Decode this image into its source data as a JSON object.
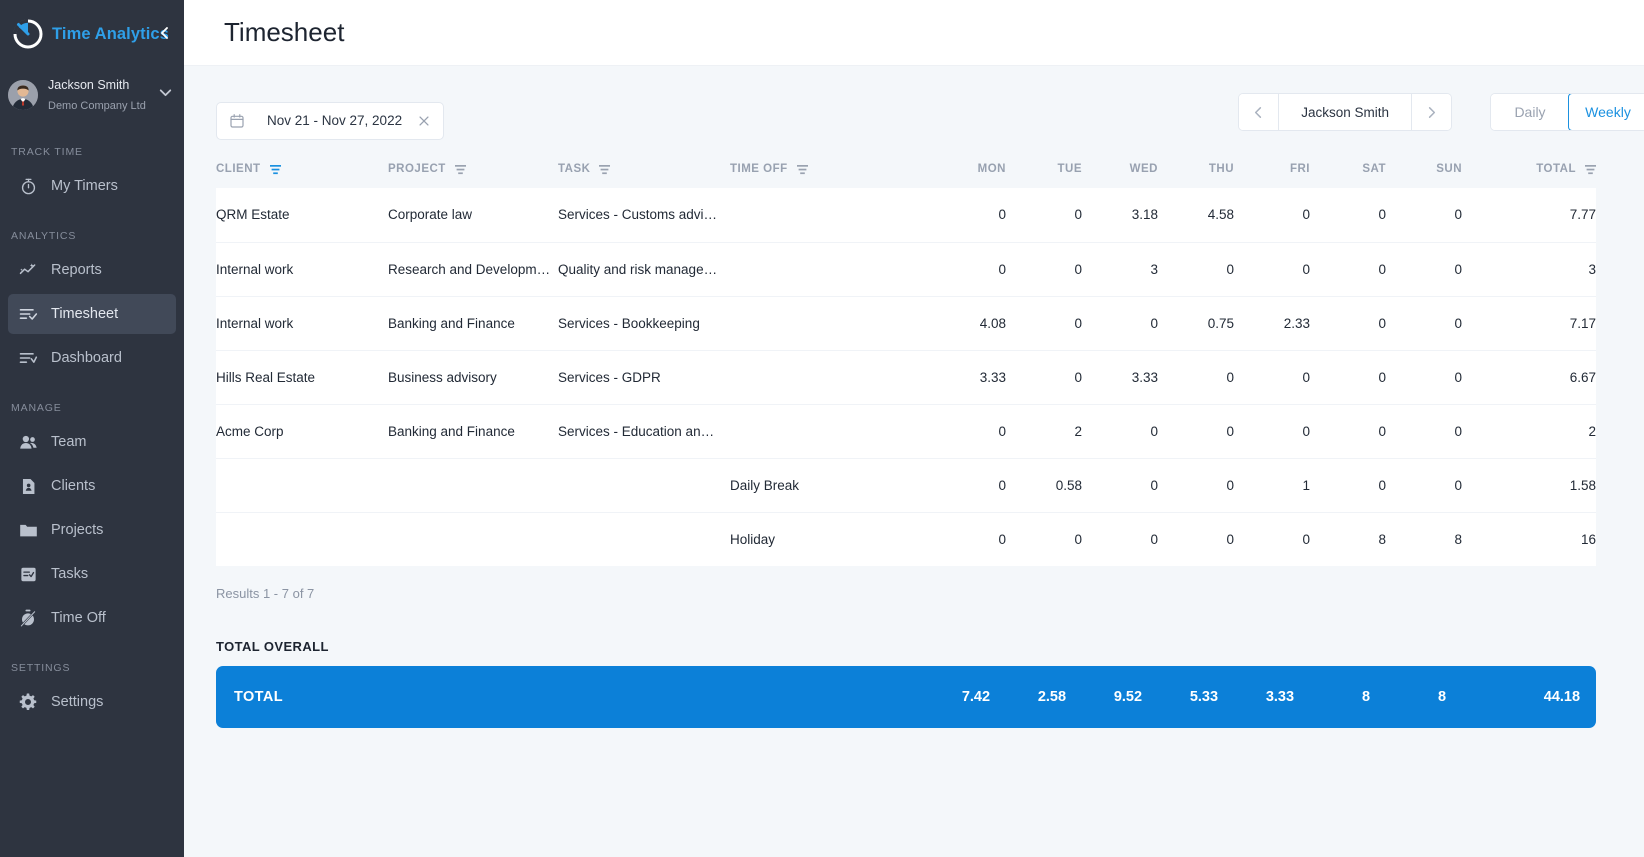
{
  "sidebar": {
    "brand": "Time Analytics",
    "collapse_icon": "chevron-left-icon",
    "user": {
      "name": "Jackson Smith",
      "company": "Demo Company Ltd",
      "chevron_icon": "chevron-down-icon"
    },
    "sections": [
      {
        "label": "TRACK TIME",
        "items": [
          {
            "label": "My Timers",
            "icon": "timer-icon",
            "active": false
          }
        ]
      },
      {
        "label": "ANALYTICS",
        "items": [
          {
            "label": "Reports",
            "icon": "chart-line-icon",
            "active": false
          },
          {
            "label": "Timesheet",
            "icon": "timesheet-check-icon",
            "active": true
          },
          {
            "label": "Dashboard",
            "icon": "dashboard-icon",
            "active": false
          }
        ]
      },
      {
        "label": "MANAGE",
        "items": [
          {
            "label": "Team",
            "icon": "people-icon",
            "active": false
          },
          {
            "label": "Clients",
            "icon": "contact-card-icon",
            "active": false
          },
          {
            "label": "Projects",
            "icon": "folder-icon",
            "active": false
          },
          {
            "label": "Tasks",
            "icon": "tasks-icon",
            "active": false
          },
          {
            "label": "Time Off",
            "icon": "timer-off-icon",
            "active": false
          }
        ]
      },
      {
        "label": "SETTINGS",
        "items": [
          {
            "label": "Settings",
            "icon": "gear-icon",
            "active": false
          }
        ]
      }
    ]
  },
  "header": {
    "title": "Timesheet"
  },
  "toolbar": {
    "date_range": "Nov 21 - Nov 27, 2022",
    "calendar_icon": "calendar-icon",
    "clear_icon": "close-icon",
    "prev_icon": "chevron-left-icon",
    "next_icon": "chevron-right-icon",
    "selected_user": "Jackson Smith",
    "view_modes": [
      {
        "label": "Daily",
        "active": false
      },
      {
        "label": "Weekly",
        "active": true
      }
    ]
  },
  "table": {
    "columns": [
      {
        "key": "client",
        "label": "CLIENT",
        "sortable": true,
        "sort_active": true
      },
      {
        "key": "project",
        "label": "PROJECT",
        "sortable": true,
        "sort_active": false
      },
      {
        "key": "task",
        "label": "TASK",
        "sortable": true,
        "sort_active": false
      },
      {
        "key": "timeoff",
        "label": "TIME OFF",
        "sortable": true,
        "sort_active": false
      },
      {
        "key": "mon",
        "label": "MON",
        "sortable": false,
        "sort_active": false
      },
      {
        "key": "tue",
        "label": "TUE",
        "sortable": false,
        "sort_active": false
      },
      {
        "key": "wed",
        "label": "WED",
        "sortable": false,
        "sort_active": false
      },
      {
        "key": "thu",
        "label": "THU",
        "sortable": false,
        "sort_active": false
      },
      {
        "key": "fri",
        "label": "FRI",
        "sortable": false,
        "sort_active": false
      },
      {
        "key": "sat",
        "label": "SAT",
        "sortable": false,
        "sort_active": false
      },
      {
        "key": "sun",
        "label": "SUN",
        "sortable": false,
        "sort_active": false
      },
      {
        "key": "total",
        "label": "TOTAL",
        "sortable": true,
        "sort_active": false
      }
    ],
    "rows": [
      {
        "client": "QRM Estate",
        "project": "Corporate law",
        "task": "Services - Customs advi…",
        "timeoff": "",
        "mon": "0",
        "tue": "0",
        "wed": "3.18",
        "thu": "4.58",
        "fri": "0",
        "sat": "0",
        "sun": "0",
        "total": "7.77"
      },
      {
        "client": "Internal work",
        "project": "Research and Developm…",
        "task": "Quality and risk manage…",
        "timeoff": "",
        "mon": "0",
        "tue": "0",
        "wed": "3",
        "thu": "0",
        "fri": "0",
        "sat": "0",
        "sun": "0",
        "total": "3"
      },
      {
        "client": "Internal work",
        "project": "Banking and Finance",
        "task": "Services - Bookkeeping",
        "timeoff": "",
        "mon": "4.08",
        "tue": "0",
        "wed": "0",
        "thu": "0.75",
        "fri": "2.33",
        "sat": "0",
        "sun": "0",
        "total": "7.17"
      },
      {
        "client": "Hills Real Estate",
        "project": "Business advisory",
        "task": "Services - GDPR",
        "timeoff": "",
        "mon": "3.33",
        "tue": "0",
        "wed": "3.33",
        "thu": "0",
        "fri": "0",
        "sat": "0",
        "sun": "0",
        "total": "6.67"
      },
      {
        "client": "Acme Corp",
        "project": "Banking and Finance",
        "task": "Services - Education an…",
        "timeoff": "",
        "mon": "0",
        "tue": "2",
        "wed": "0",
        "thu": "0",
        "fri": "0",
        "sat": "0",
        "sun": "0",
        "total": "2"
      },
      {
        "client": "",
        "project": "",
        "task": "",
        "timeoff": "Daily Break",
        "mon": "0",
        "tue": "0.58",
        "wed": "0",
        "thu": "0",
        "fri": "1",
        "sat": "0",
        "sun": "0",
        "total": "1.58"
      },
      {
        "client": "",
        "project": "",
        "task": "",
        "timeoff": "Holiday",
        "mon": "0",
        "tue": "0",
        "wed": "0",
        "thu": "0",
        "fri": "0",
        "sat": "8",
        "sun": "8",
        "total": "16"
      }
    ],
    "results_text": "Results 1 - 7 of 7"
  },
  "total_overall": {
    "section_label": "TOTAL OVERALL",
    "row_label": "TOTAL",
    "mon": "7.42",
    "tue": "2.58",
    "wed": "9.52",
    "thu": "5.33",
    "fri": "3.33",
    "sat": "8",
    "sun": "8",
    "total": "44.18"
  },
  "colors": {
    "brand_blue": "#2f9fe8",
    "accent_blue": "#0c80d8",
    "sidebar_bg": "#2e3440",
    "page_bg": "#f4f7fa"
  }
}
